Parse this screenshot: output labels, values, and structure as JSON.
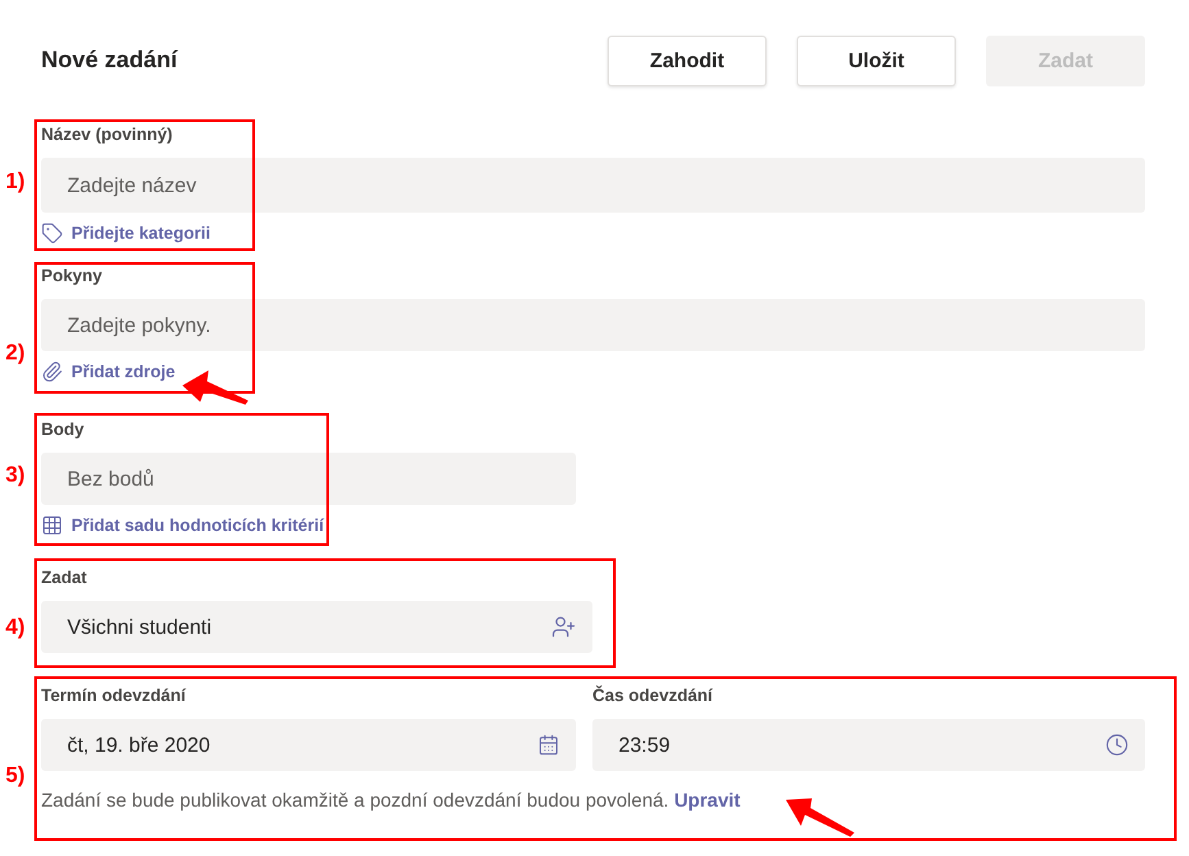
{
  "header": {
    "title": "Nové zadání",
    "buttons": [
      {
        "label": "Zahodit",
        "disabled": false
      },
      {
        "label": "Uložit",
        "disabled": false
      },
      {
        "label": "Zadat",
        "disabled": true
      }
    ]
  },
  "sections": [
    {
      "kind": "name",
      "label": "Název (povinný)",
      "placeholder": "Zadejte název",
      "link": "Přidejte kategorii"
    },
    {
      "kind": "instructions",
      "label": "Pokyny",
      "placeholder": "Zadejte pokyny.",
      "link": "Přidat zdroje"
    },
    {
      "kind": "points",
      "label": "Body",
      "placeholder": "Bez bodů",
      "link": "Přidat sadu hodnoticích kritérií"
    },
    {
      "kind": "assign",
      "label": "Zadat",
      "value": "Všichni studenti"
    },
    {
      "kind": "due",
      "fields": [
        {
          "kind": "date",
          "label": "Termín odevzdání",
          "value": "čt, 19. bře 2020"
        },
        {
          "kind": "time",
          "label": "Čas odevzdání",
          "value": "23:59"
        }
      ],
      "note": "Zadání se bude publikovat okamžitě a pozdní odevzdání budou povolená.",
      "note_link": "Upravit"
    }
  ],
  "annotations": [
    {
      "label": "1)"
    },
    {
      "label": "2)"
    },
    {
      "label": "3)"
    },
    {
      "label": "4)"
    },
    {
      "label": "5)"
    }
  ]
}
